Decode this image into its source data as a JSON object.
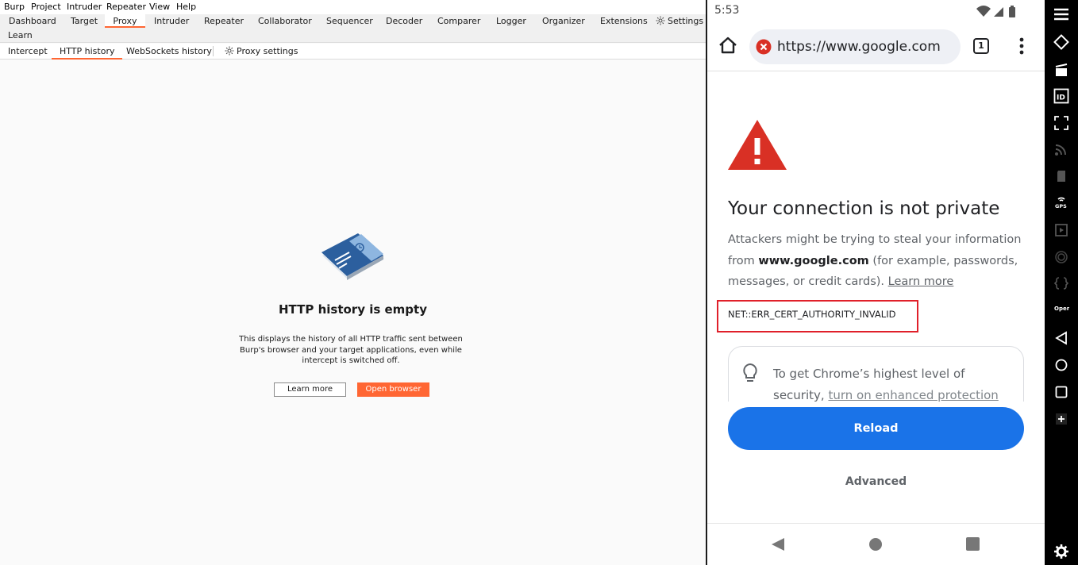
{
  "burp": {
    "menu": [
      "Burp",
      "Project",
      "Intruder",
      "Repeater",
      "View",
      "Help"
    ],
    "main_tabs": [
      "Dashboard",
      "Target",
      "Proxy",
      "Intruder",
      "Repeater",
      "Collaborator",
      "Sequencer",
      "Decoder",
      "Comparer",
      "Logger",
      "Organizer",
      "Extensions",
      "Settings",
      "Learn"
    ],
    "active_main_tab": "Proxy",
    "sub_tabs": [
      "Intercept",
      "HTTP history",
      "WebSockets history",
      "Proxy settings"
    ],
    "active_sub_tab": "HTTP history",
    "empty_state": {
      "title": "HTTP history is empty",
      "description": "This displays the history of all HTTP traffic sent between Burp's browser and your target applications, even while intercept is switched off.",
      "learn_more": "Learn more",
      "open_browser": "Open browser"
    },
    "accent_color": "#ff6633"
  },
  "android": {
    "status_time": "5:53",
    "url": "https://www.google.com",
    "tab_count": "1",
    "error_page": {
      "title": "Your connection is not private",
      "body_prefix": "Attackers might be trying to steal your information from ",
      "body_domain": "www.google.com",
      "body_suffix": " (for example, passwords, messages, or credit cards). ",
      "learn_more": "Learn more",
      "error_code": "NET::ERR_CERT_AUTHORITY_INVALID",
      "tip_text": "To get Chrome’s highest level of security,",
      "tip_link": "turn on enhanced protection",
      "reload": "Reload",
      "advanced": "Advanced"
    },
    "colors": {
      "reload_button": "#1a73e8",
      "warning_icon": "#d93025",
      "highlight_box": "#e0202a"
    }
  },
  "emulator_sidebar": {
    "icons": [
      "menu-icon",
      "rotate-icon",
      "screen-record-icon",
      "id-icon",
      "resize-icon",
      "network-icon",
      "sd-card-icon",
      "gps-icon",
      "media-icon",
      "fingerprint-icon",
      "code-icon",
      "opengapps-icon",
      "back-icon",
      "home-icon",
      "recents-icon",
      "add-icon",
      "settings-icon"
    ],
    "gps_label": "GPS",
    "opengapps_label": "Open GAPPS"
  }
}
